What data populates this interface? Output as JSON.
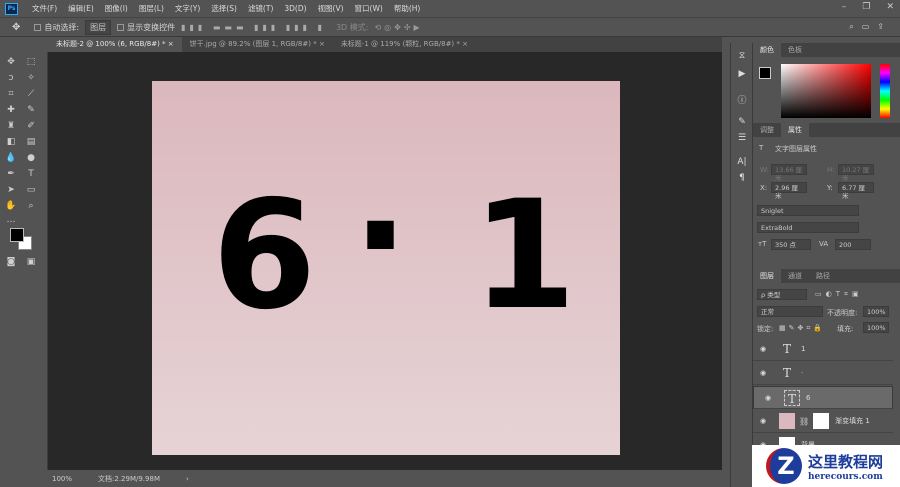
{
  "app": {
    "logo": "Ps"
  },
  "menu": [
    "文件(F)",
    "编辑(E)",
    "图像(I)",
    "图层(L)",
    "文字(Y)",
    "选择(S)",
    "滤镜(T)",
    "3D(D)",
    "视图(V)",
    "窗口(W)",
    "帮助(H)"
  ],
  "window_buttons": {
    "minimize": "–",
    "restore": "❐",
    "close": "✕"
  },
  "options": {
    "auto_select_label": "自动选择:",
    "auto_select_value": "图层",
    "show_transform_label": "显示变换控件",
    "mode_3d": "3D 模式:"
  },
  "tabs": [
    {
      "label": "未标题-2 @ 100% (6, RGB/8#) *",
      "close": "×"
    },
    {
      "label": "饼干.jpg @ 89.2% (图层 1, RGB/8#) *",
      "close": "×"
    },
    {
      "label": "未标题-1 @ 119% (颗粒, RGB/8#) *",
      "close": "×"
    }
  ],
  "canvas": {
    "chars": [
      "6",
      "·",
      "1"
    ]
  },
  "status": {
    "zoom": "100%",
    "doc": "文档:2.29M/9.98M",
    "arrow": "›"
  },
  "color_panel": {
    "tabs": [
      "颜色",
      "色板"
    ]
  },
  "properties": {
    "tabs": [
      "调整",
      "属性"
    ],
    "title": "文字图层属性",
    "w_label": "W:",
    "w_value": "13.66 厘米",
    "h_label": "H:",
    "h_value": "10.27 厘米",
    "x_label": "X:",
    "x_value": "2.96 厘米",
    "y_label": "Y:",
    "y_value": "6.77 厘米",
    "font": "Sniglet",
    "style": "ExtraBold",
    "size": "350 点",
    "tracking": "200"
  },
  "layers_panel": {
    "tabs": [
      "图层",
      "通道",
      "路径"
    ],
    "filter": "ρ 类型",
    "blend": "正常",
    "opacity_label": "不透明度:",
    "opacity": "100%",
    "lock_label": "锁定:",
    "fill_label": "填充:",
    "fill": "100%",
    "layers": [
      {
        "name": "1",
        "type": "T"
      },
      {
        "name": "·",
        "type": "T"
      },
      {
        "name": "6",
        "type": "T"
      },
      {
        "name": "渐变填充 1",
        "type": "fill"
      },
      {
        "name": "背景",
        "type": "bg"
      }
    ]
  },
  "watermark": {
    "title": "这里教程网",
    "url": "herecours.com"
  },
  "colors": {
    "canvas_top": "#dbb8bd",
    "canvas_bottom": "#e6d3d6",
    "workspace": "#282828",
    "ui": "#535353"
  }
}
